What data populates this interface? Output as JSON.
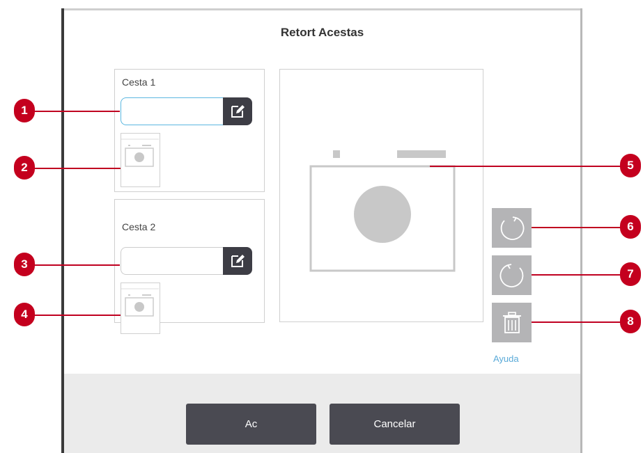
{
  "dialog": {
    "title": "Retort Acestas",
    "basket1": {
      "label": "Cesta 1",
      "name_value": ""
    },
    "basket2": {
      "label": "Cesta 2",
      "name_value": ""
    },
    "help_label": "Ayuda",
    "ok_label": "Ac",
    "cancel_label": "Cancelar"
  },
  "callouts": [
    "1",
    "2",
    "3",
    "4",
    "5",
    "6",
    "7",
    "8"
  ],
  "icons": {
    "edit": "pencil-edit-icon",
    "rotate_cw": "rotate-clockwise-icon",
    "rotate_ccw": "rotate-counterclockwise-icon",
    "delete": "trash-icon",
    "photo_placeholder": "camera-icon"
  },
  "colors": {
    "callout": "#c4001e",
    "footer_button": "#4a4a52",
    "side_button": "#b4b4b6",
    "help_link": "#5aaad8",
    "active_input_border": "#5bb7e0"
  }
}
